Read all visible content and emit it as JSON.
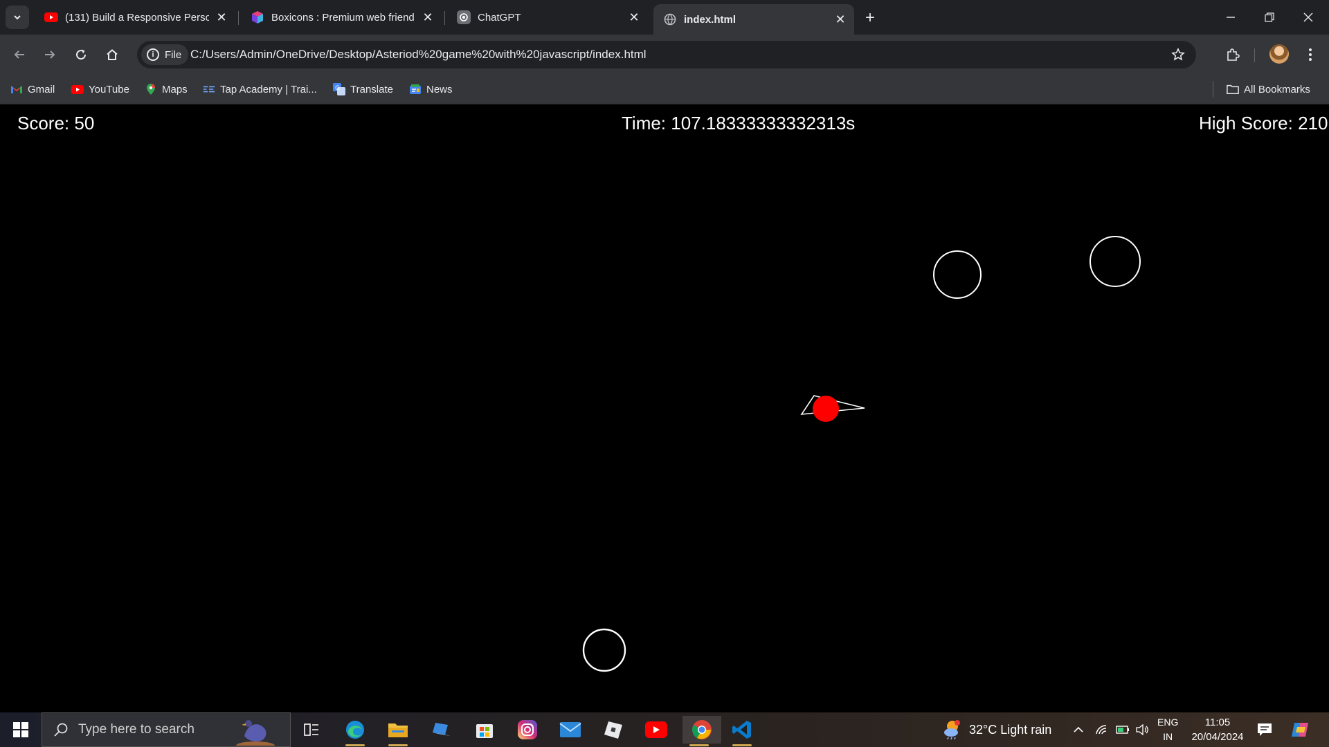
{
  "browser": {
    "tabs": [
      {
        "title": "(131) Build a Responsive Persor",
        "icon": "youtube-icon"
      },
      {
        "title": "Boxicons : Premium web friend",
        "icon": "boxicons-icon"
      },
      {
        "title": "ChatGPT",
        "icon": "chatgpt-icon"
      },
      {
        "title": "index.html",
        "icon": "globe-icon",
        "active": true
      }
    ],
    "url_chip": "File",
    "url": "C:/Users/Admin/OneDrive/Desktop/Asteriod%20game%20with%20javascript/index.html",
    "bookmarks": [
      {
        "label": "Gmail",
        "icon": "gmail-icon"
      },
      {
        "label": "YouTube",
        "icon": "youtube-icon"
      },
      {
        "label": "Maps",
        "icon": "maps-icon"
      },
      {
        "label": "Tap Academy | Trai...",
        "icon": "tap-academy-icon"
      },
      {
        "label": "Translate",
        "icon": "translate-icon"
      },
      {
        "label": "News",
        "icon": "news-icon"
      }
    ],
    "all_bookmarks": "All Bookmarks"
  },
  "game": {
    "score": "Score: 50",
    "time": "Time: 107.18333333332313s",
    "high_score": "High Score: 210",
    "ship_color": "#ffffff",
    "bullet_color": "#ff0000"
  },
  "taskbar": {
    "search_placeholder": "Type here to search",
    "weather": "32°C  Light rain",
    "lang_line1": "ENG",
    "lang_line2": "IN",
    "time": "11:05",
    "date": "20/04/2024"
  },
  "colors": {
    "tabstrip": "#202124",
    "toolbar": "#35363a",
    "accent_red": "#ff0000"
  }
}
